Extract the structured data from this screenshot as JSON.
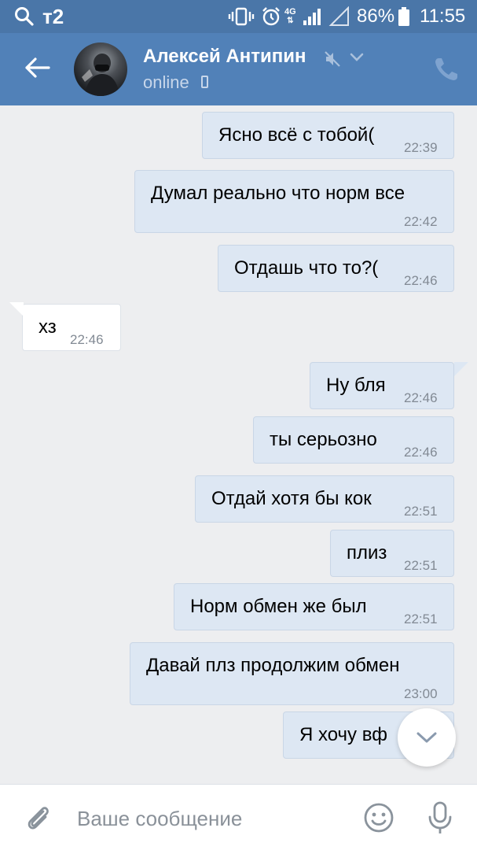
{
  "status_bar": {
    "carrier": "т2",
    "network": "4G",
    "battery": "86%",
    "time": "11:55"
  },
  "header": {
    "contact_name": "Алексей Антипин",
    "status": "online"
  },
  "messages": [
    {
      "direction": "out",
      "text": "Ясно всё с тобой(",
      "time": "22:39"
    },
    {
      "direction": "out",
      "text": "Думал реально что норм все",
      "time": "22:42"
    },
    {
      "direction": "out",
      "text": "Отдашь что то?(",
      "time": "22:46"
    },
    {
      "direction": "in",
      "text": "хз",
      "time": "22:46"
    },
    {
      "direction": "out",
      "text": "Ну бля",
      "time": "22:46"
    },
    {
      "direction": "out",
      "text": "ты серьозно",
      "time": "22:46"
    },
    {
      "direction": "out",
      "text": "Отдай хотя бы кок",
      "time": "22:51"
    },
    {
      "direction": "out",
      "text": "плиз",
      "time": "22:51"
    },
    {
      "direction": "out",
      "text": "Норм обмен же был",
      "time": "22:51"
    },
    {
      "direction": "out",
      "text": "Давай плз продолжим обмен",
      "time": "23:00"
    },
    {
      "direction": "out",
      "text": "Я хочу вф",
      "time": ""
    }
  ],
  "input": {
    "placeholder": "Ваше сообщение"
  },
  "colors": {
    "header": "#5181b8",
    "status_bar": "#4a76a8",
    "outgoing_bubble": "#dde7f3",
    "incoming_bubble": "#ffffff",
    "background": "#edeef0"
  },
  "icons": {
    "search": "search-icon",
    "vibrate": "vibrate-icon",
    "alarm": "alarm-icon",
    "signal": "signal-icon",
    "battery": "battery-icon",
    "back": "arrow-back-icon",
    "mute": "mute-icon",
    "chevron": "chevron-down-icon",
    "phone": "phone-icon",
    "mobile": "mobile-icon",
    "attach": "paperclip-icon",
    "emoji": "smile-icon",
    "mic": "microphone-icon",
    "scroll_down": "chevron-down-icon"
  }
}
